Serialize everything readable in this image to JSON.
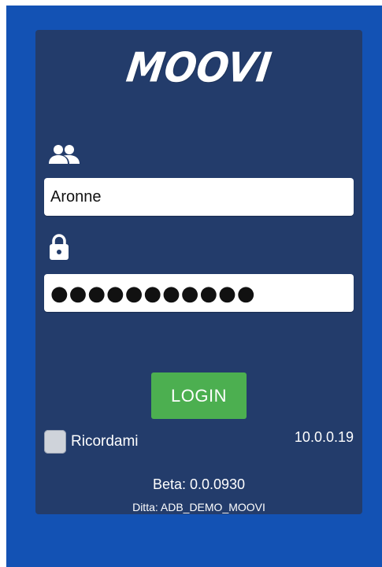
{
  "app": {
    "logo_text": "MOOVI"
  },
  "login": {
    "username_icon": "users-icon",
    "username_value": "Aronne",
    "password_icon": "lock-icon",
    "password_masked": "●●●●●●●●●●●",
    "login_label": "LOGIN",
    "remember_label": "Ricordami",
    "remember_checked": false
  },
  "footer": {
    "ip": "10.0.0.19",
    "beta": "Beta: 0.0.0930",
    "ditta": "Ditta: ADB_DEMO_MOOVI"
  },
  "colors": {
    "background": "#1352b4",
    "panel": "#233c6b",
    "login_button": "#4caf50"
  }
}
